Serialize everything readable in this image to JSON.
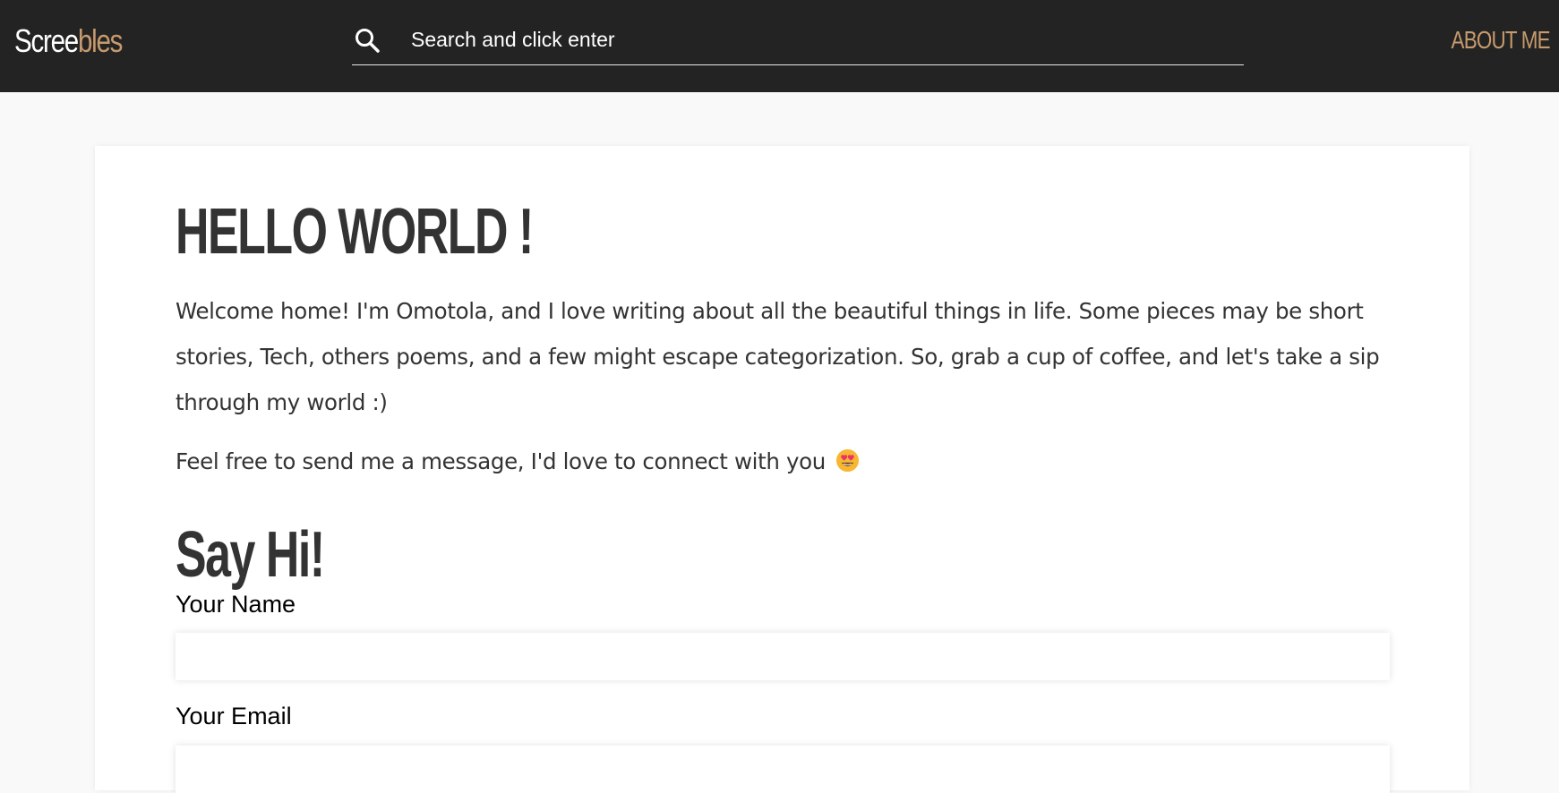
{
  "header": {
    "logo_part1": "Scree",
    "logo_part2": "bles",
    "search_placeholder": "Search and click enter",
    "about_label": "ABOUT ME",
    "search_icon": "search-icon"
  },
  "main": {
    "title": "HELLO WORLD !",
    "intro": "Welcome home! I'm Omotola, and I love writing about all the beautiful things in life. Some pieces may be short stories, Tech, others poems, and a few might escape categorization. So, grab a cup of coffee, and let's take a sip through my world :)",
    "invite": "Feel free to send me a message, I'd love to connect with you",
    "invite_emoji": "smiling-face-with-heart-eyes-icon"
  },
  "contact": {
    "heading": "Say Hi!",
    "name_label": "Your Name",
    "name_value": "",
    "email_label": "Your Email",
    "email_value": ""
  },
  "colors": {
    "header_bg": "#232323",
    "accent": "#c69a6d",
    "page_bg": "#f9f9f9",
    "text": "#333333"
  }
}
